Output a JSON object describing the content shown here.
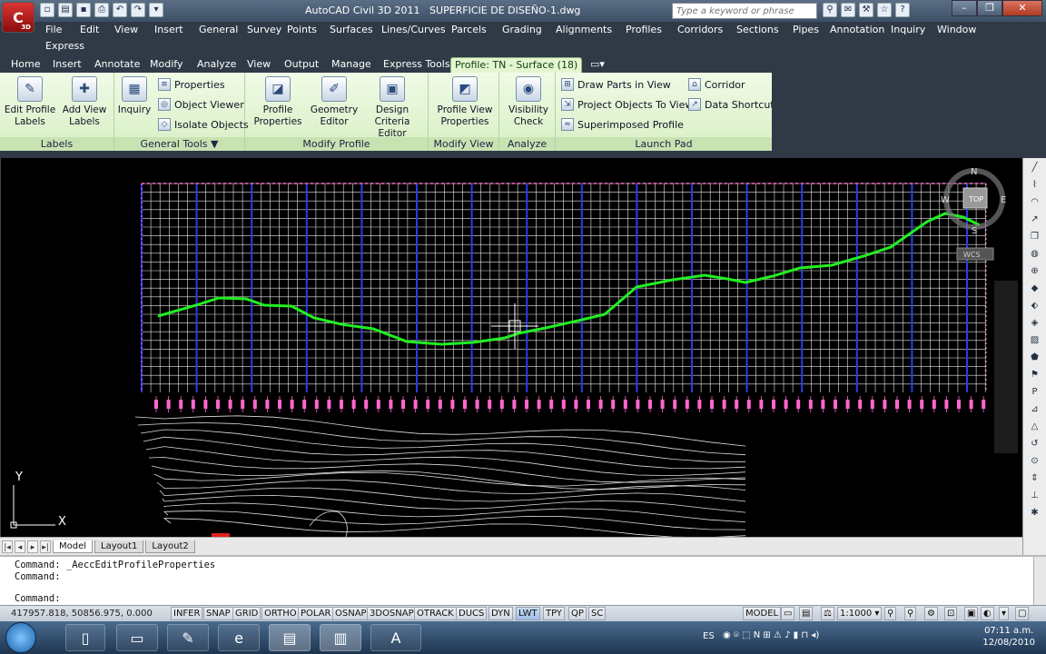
{
  "app": {
    "title": "AutoCAD Civil 3D 2011",
    "document": "SUPERFICIE DE DISEÑO-1.dwg",
    "app_button_letter": "C",
    "app_button_sub": "3D"
  },
  "search": {
    "placeholder": "Type a keyword or phrase"
  },
  "menubar": {
    "row1": [
      "File",
      "Edit",
      "View",
      "Insert",
      "General",
      "Survey",
      "Points",
      "Surfaces",
      "Lines/Curves",
      "Parcels",
      "Grading",
      "Alignments",
      "Profiles",
      "Corridors",
      "Sections",
      "Pipes",
      "Annotation",
      "Inquiry",
      "Window"
    ],
    "row2": [
      "Express"
    ]
  },
  "ribbon_tabs": [
    "Home",
    "Insert",
    "Annotate",
    "Modify",
    "Analyze",
    "View",
    "Output",
    "Manage",
    "Express Tools",
    "Profile: TN - Surface (18)"
  ],
  "ribbon": {
    "labels": {
      "title": "Labels",
      "edit_profile_labels": [
        "Edit Profile",
        "Labels"
      ],
      "add_view_labels": [
        "Add View",
        "Labels"
      ]
    },
    "general_tools": {
      "title": "General Tools ▼",
      "inquiry": "Inquiry",
      "properties": "Properties",
      "object_viewer": "Object Viewer",
      "isolate_objects": "Isolate Objects"
    },
    "modify_profile": {
      "title": "Modify Profile",
      "profile_properties": [
        "Profile",
        "Properties"
      ],
      "geometry_editor": [
        "Geometry",
        "Editor"
      ],
      "design_criteria_editor": [
        "Design Criteria",
        "Editor"
      ]
    },
    "modify_view": {
      "title": "Modify View",
      "profile_view_properties": [
        "Profile View",
        "Properties"
      ]
    },
    "analyze": {
      "title": "Analyze",
      "visibility_check": [
        "Visibility",
        "Check"
      ]
    },
    "launch_pad": {
      "title": "Launch Pad",
      "draw_parts_in_view": "Draw Parts in View",
      "project_objects_to_view": "Project Objects To View",
      "superimposed_profile": "Superimposed Profile",
      "corridor": "Corridor",
      "data_shortcut": "Data Shortcut"
    }
  },
  "viewcube": {
    "n": "N",
    "s": "S",
    "e": "E",
    "w": "W",
    "face": "TOP",
    "wcs": "WCS"
  },
  "ucs": {
    "y": "Y",
    "x": "X"
  },
  "layout_tabs": [
    "Model",
    "Layout1",
    "Layout2"
  ],
  "command": {
    "line1": "Command:  _AeccEditProfileProperties",
    "line2": "Command:",
    "prompt": "Command:"
  },
  "status": {
    "coords": "417957.818, 50856.975, 0.000",
    "toggles": [
      "INFER",
      "SNAP",
      "GRID",
      "ORTHO",
      "POLAR",
      "OSNAP",
      "3DOSNAP",
      "OTRACK",
      "DUCS",
      "DYN",
      "LWT",
      "TPY",
      "QP",
      "SC"
    ],
    "active_toggle": "LWT",
    "model": "MODEL",
    "scale": "1:1000"
  },
  "taskbar": {
    "lang": "ES",
    "time": "07:11 a.m.",
    "date": "12/08/2010"
  },
  "colors": {
    "profile_line": "#22ee22",
    "grid": "#e6e6e6",
    "grid_major": "#2b3be8",
    "station_labels": "#ff66cc",
    "ribbon_bg": "#e4f5d0"
  }
}
